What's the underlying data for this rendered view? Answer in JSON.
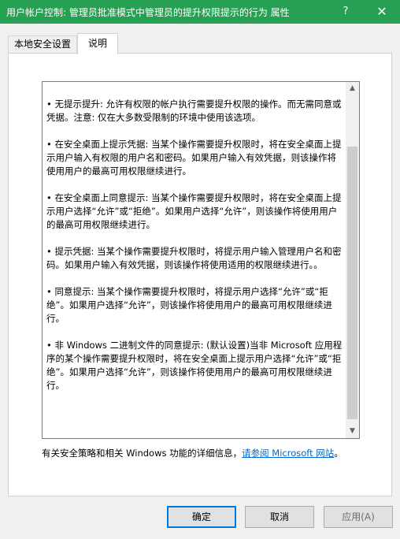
{
  "window": {
    "title": "用户帐户控制: 管理员批准模式中管理员的提升权限提示的行为 属性",
    "help_label": "?",
    "close_label": "✕"
  },
  "tabs": [
    {
      "label": "本地安全设置"
    },
    {
      "label": "说明"
    }
  ],
  "description": {
    "paragraphs": [
      "• 无提示提升: 允许有权限的帐户执行需要提升权限的操作。而无需同意或凭据。注意: 仅在大多数受限制的环境中使用该选项。",
      "• 在安全桌面上提示凭据: 当某个操作需要提升权限时，将在安全桌面上提示用户输入有权限的用户名和密码。如果用户输入有效凭据，则该操作将使用用户的最高可用权限继续进行。",
      "• 在安全桌面上同意提示: 当某个操作需要提升权限时，将在安全桌面上提示用户选择“允许”或“拒绝”。如果用户选择“允许”，则该操作将使用用户的最高可用权限继续进行。",
      "• 提示凭据: 当某个操作需要提升权限时，将提示用户输入管理用户名和密码。如果用户输入有效凭据，则该操作将使用适用的权限继续进行。。",
      "• 同意提示: 当某个操作需要提升权限时，将提示用户选择“允许”或“拒绝”。如果用户选择“允许”，则该操作将使用用户的最高可用权限继续进行。",
      "• 非 Windows 二进制文件的同意提示: (默认设置)当非 Microsoft 应用程序的某个操作需要提升权限时，将在安全桌面上提示用户选择“允许”或“拒绝”。如果用户选择“允许”，则该操作将使用用户的最高可用权限继续进行。"
    ],
    "scroll_up": "▲",
    "scroll_down": "▼"
  },
  "footer": {
    "text": "有关安全策略和相关 Windows 功能的详细信息，",
    "link": "请参阅 Microsoft 网站",
    "suffix": "。"
  },
  "buttons": {
    "ok": "确定",
    "cancel": "取消",
    "apply": "应用(A)"
  }
}
